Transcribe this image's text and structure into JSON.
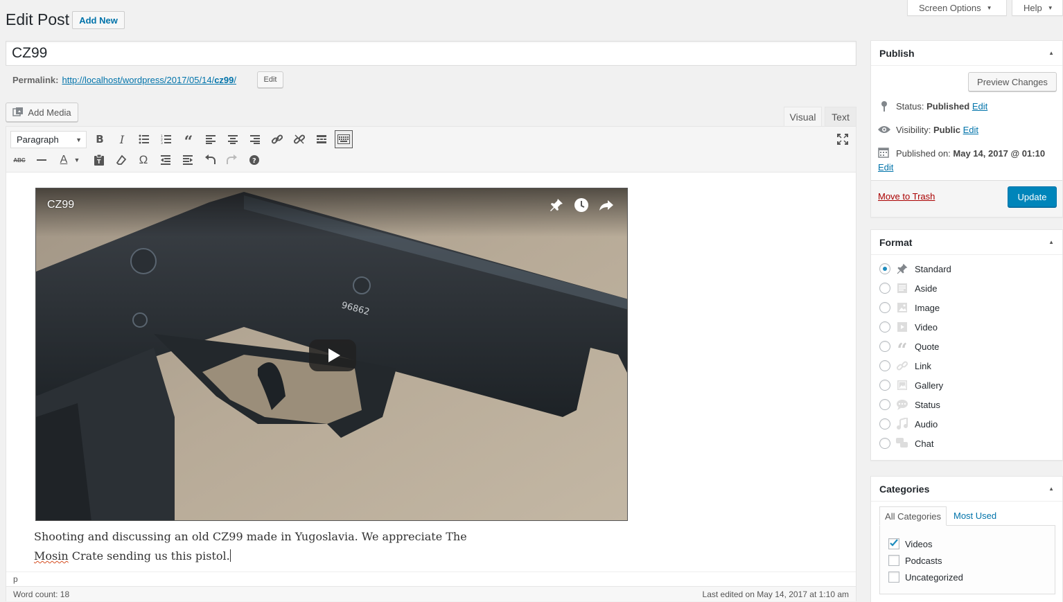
{
  "header": {
    "title": "Edit Post",
    "add_new": "Add New",
    "screen_options": "Screen Options",
    "help": "Help"
  },
  "post": {
    "title_value": "CZ99",
    "permalink_label": "Permalink:",
    "permalink_prefix": "http://localhost/wordpress/2017/05/14/",
    "permalink_slug": "cz99",
    "permalink_suffix": "/",
    "permalink_edit": "Edit"
  },
  "editor": {
    "add_media": "Add Media",
    "tab_visual": "Visual",
    "tab_text": "Text",
    "format_select": "Paragraph",
    "video_title": "CZ99",
    "serial_number": "96862",
    "content_line1": "Shooting and discussing an old CZ99 made in Yugoslavia. We appreciate The",
    "content_line2_word": "Mosin",
    "content_line2_rest": " Crate sending us this pistol.",
    "path": "p",
    "word_count": "Word count: 18",
    "last_edited": "Last edited on May 14, 2017 at 1:10 am"
  },
  "publish": {
    "title": "Publish",
    "preview_changes": "Preview Changes",
    "status_label": "Status:",
    "status_value": "Published",
    "status_edit": "Edit",
    "visibility_label": "Visibility:",
    "visibility_value": "Public",
    "visibility_edit": "Edit",
    "published_label": "Published on:",
    "published_value": "May 14, 2017 @ 01:10",
    "published_edit": "Edit",
    "move_to_trash": "Move to Trash",
    "update": "Update"
  },
  "format": {
    "title": "Format",
    "selected": "Standard",
    "options": [
      {
        "label": "Standard",
        "icon": "pushpin-icon"
      },
      {
        "label": "Aside",
        "icon": "aside-icon"
      },
      {
        "label": "Image",
        "icon": "image-icon"
      },
      {
        "label": "Video",
        "icon": "video-icon"
      },
      {
        "label": "Quote",
        "icon": "quote-icon"
      },
      {
        "label": "Link",
        "icon": "link-icon"
      },
      {
        "label": "Gallery",
        "icon": "gallery-icon"
      },
      {
        "label": "Status",
        "icon": "status-icon"
      },
      {
        "label": "Audio",
        "icon": "audio-icon"
      },
      {
        "label": "Chat",
        "icon": "chat-icon"
      }
    ]
  },
  "categories": {
    "title": "Categories",
    "tab_all": "All Categories",
    "tab_most_used": "Most Used",
    "items": [
      {
        "label": "Videos",
        "checked": true
      },
      {
        "label": "Podcasts",
        "checked": false
      },
      {
        "label": "Uncategorized",
        "checked": false
      }
    ]
  },
  "colors": {
    "primary_button": "#0085ba",
    "link": "#0073aa",
    "trash": "#a00",
    "radio_dot": "#1e8cbe"
  }
}
